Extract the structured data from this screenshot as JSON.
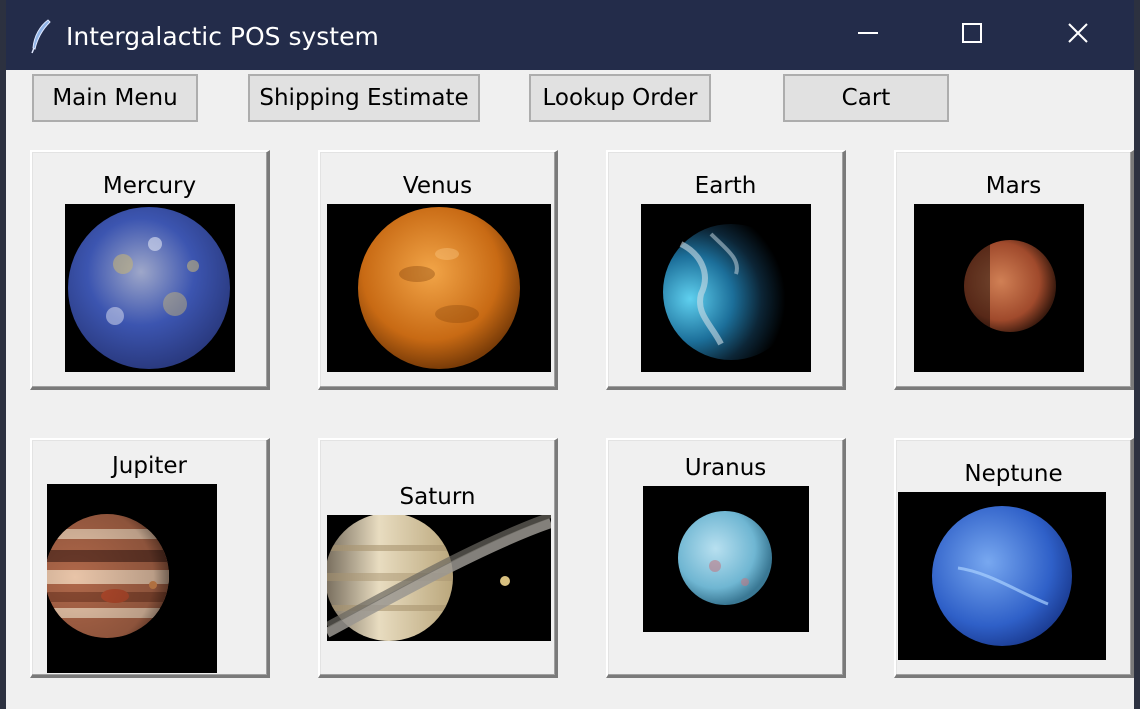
{
  "window": {
    "title": "Intergalactic POS system",
    "icons": {
      "app": "feather-icon",
      "minimize": "minimize-icon",
      "maximize": "maximize-icon",
      "close": "close-icon"
    }
  },
  "nav": {
    "main_menu": "Main Menu",
    "shipping_estimate": "Shipping Estimate",
    "lookup_order": "Lookup Order",
    "cart": "Cart"
  },
  "planets": [
    {
      "name": "Mercury",
      "colors": [
        "#9ea7c9",
        "#3c55b0",
        "#c2b27a"
      ]
    },
    {
      "name": "Venus",
      "colors": [
        "#f2a548",
        "#c86a14",
        "#7a3c08"
      ]
    },
    {
      "name": "Earth",
      "colors": [
        "#5fd0ef",
        "#1c6f9a",
        "#cfdde6"
      ]
    },
    {
      "name": "Mars",
      "colors": [
        "#d08055",
        "#a04a2c",
        "#6a2c18"
      ]
    },
    {
      "name": "Jupiter",
      "colors": [
        "#e8c4a8",
        "#b0684a",
        "#6b3a2a"
      ]
    },
    {
      "name": "Saturn",
      "colors": [
        "#e8dcc0",
        "#b8a478",
        "#7a7060"
      ]
    },
    {
      "name": "Uranus",
      "colors": [
        "#b8e0f0",
        "#6fb6d2",
        "#c07a86"
      ]
    },
    {
      "name": "Neptune",
      "colors": [
        "#78a8f0",
        "#2f60c8",
        "#1a3a90"
      ]
    }
  ]
}
